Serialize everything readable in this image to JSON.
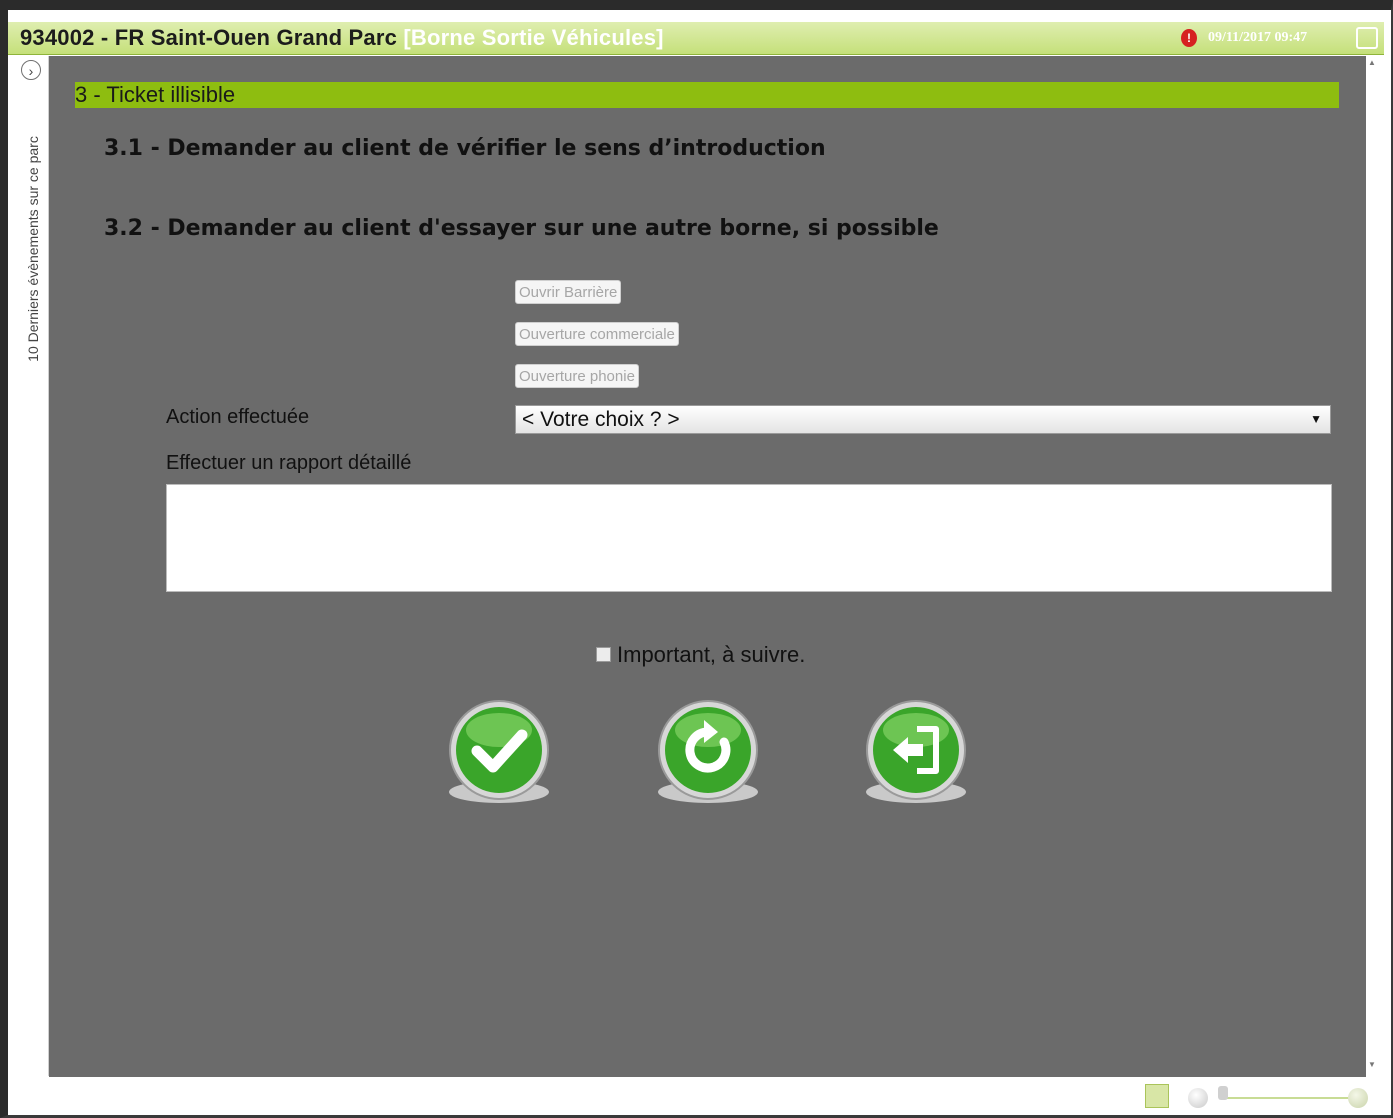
{
  "window": {
    "title_prefix": "934002 - FR Saint-Ouen Grand Parc ",
    "title_highlight": "[Borne Sortie Véhicules]",
    "alert_badge": "!",
    "datetime": "09/11/2017 09:47"
  },
  "sidebar": {
    "expand_glyph": "›",
    "label": "10 Derniers évènements sur ce parc"
  },
  "main": {
    "section_title": "3 - Ticket illisible",
    "step_1": "3.1 - Demander au client de vérifier le sens d’introduction",
    "step_2": "3.2 - Demander au client d'essayer sur une autre borne, si possible",
    "buttons": {
      "open_barrier": "Ouvrir Barrière",
      "commercial_opening": "Ouverture commerciale",
      "phone_opening": "Ouverture phonie"
    },
    "action_label": "Action effectuée",
    "action_select_value": "< Votre choix ? >",
    "report_label": "Effectuer un rapport détaillé",
    "report_value": "",
    "important_checked": false,
    "important_label": "Important, à suivre.",
    "actions": {
      "validate_icon": "check-icon",
      "reset_icon": "refresh-icon",
      "exit_icon": "exit-icon"
    }
  },
  "colors": {
    "title_bar": "#c5e07a",
    "section_bar": "#8ebd10",
    "panel_bg": "#6b6b6b",
    "action_green": "#3aa52a"
  }
}
